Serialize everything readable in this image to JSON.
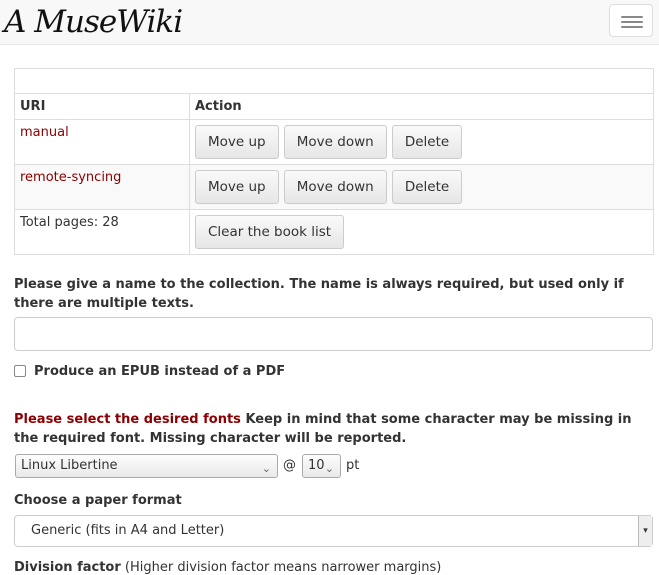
{
  "navbar": {
    "brand": "A MuseWiki",
    "menu_icon": "hamburger-icon"
  },
  "table": {
    "headers": [
      "URI",
      "Action"
    ],
    "rows": [
      {
        "uri": "manual"
      },
      {
        "uri": "remote-syncing"
      }
    ],
    "actions": {
      "move_up": "Move up",
      "move_down": "Move down",
      "delete": "Delete"
    },
    "total_pages": "Total pages: 28",
    "clear_label": "Clear the book list"
  },
  "collection": {
    "name_label": "Please give a name to the collection. The name is always required, but used only if there are multiple texts.",
    "name_value": ""
  },
  "epub": {
    "label": "Produce an EPUB instead of a PDF",
    "checked": false
  },
  "fonts": {
    "highlight": "Please select the desired fonts",
    "note": "Keep in mind that some character may be missing in the required font. Missing character will be reported.",
    "font_value": "Linux Libertine",
    "at": "@",
    "size_value": "10",
    "unit": "pt"
  },
  "paper": {
    "label": "Choose a paper format",
    "value": "Generic (fits in A4 and Letter)"
  },
  "division": {
    "label": "Division factor",
    "note": "(Higher division factor means narrower margins)"
  }
}
